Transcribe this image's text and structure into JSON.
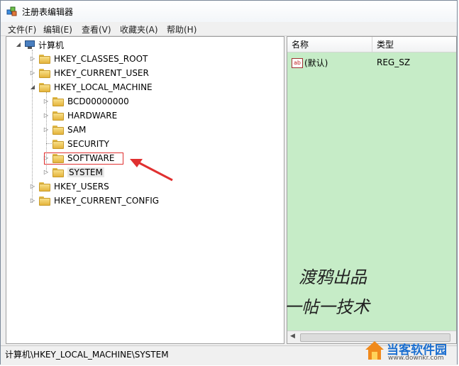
{
  "window": {
    "title": "注册表编辑器"
  },
  "menu": [
    "文件(F)",
    "编辑(E)",
    "查看(V)",
    "收藏夹(A)",
    "帮助(H)"
  ],
  "tree": {
    "root": "计算机",
    "hives": [
      {
        "label": "HKEY_CLASSES_ROOT"
      },
      {
        "label": "HKEY_CURRENT_USER"
      },
      {
        "label": "HKEY_LOCAL_MACHINE",
        "children": [
          "BCD00000000",
          "HARDWARE",
          "SAM",
          "SECURITY",
          "SOFTWARE",
          "SYSTEM"
        ]
      },
      {
        "label": "HKEY_USERS"
      },
      {
        "label": "HKEY_CURRENT_CONFIG"
      }
    ]
  },
  "list": {
    "columns": [
      "名称",
      "类型"
    ],
    "rows": [
      {
        "name": "(默认)",
        "type": "REG_SZ"
      }
    ]
  },
  "status": "计算机\\HKEY_LOCAL_MACHINE\\SYSTEM",
  "watermark": {
    "line1": "渡鸦出品",
    "line2": "一帖一技术"
  },
  "logo": {
    "name": "当客软件园",
    "url": "www.downkr.com"
  },
  "colors": {
    "list_bg": "#c6ecc7",
    "highlight": "#e03030"
  }
}
